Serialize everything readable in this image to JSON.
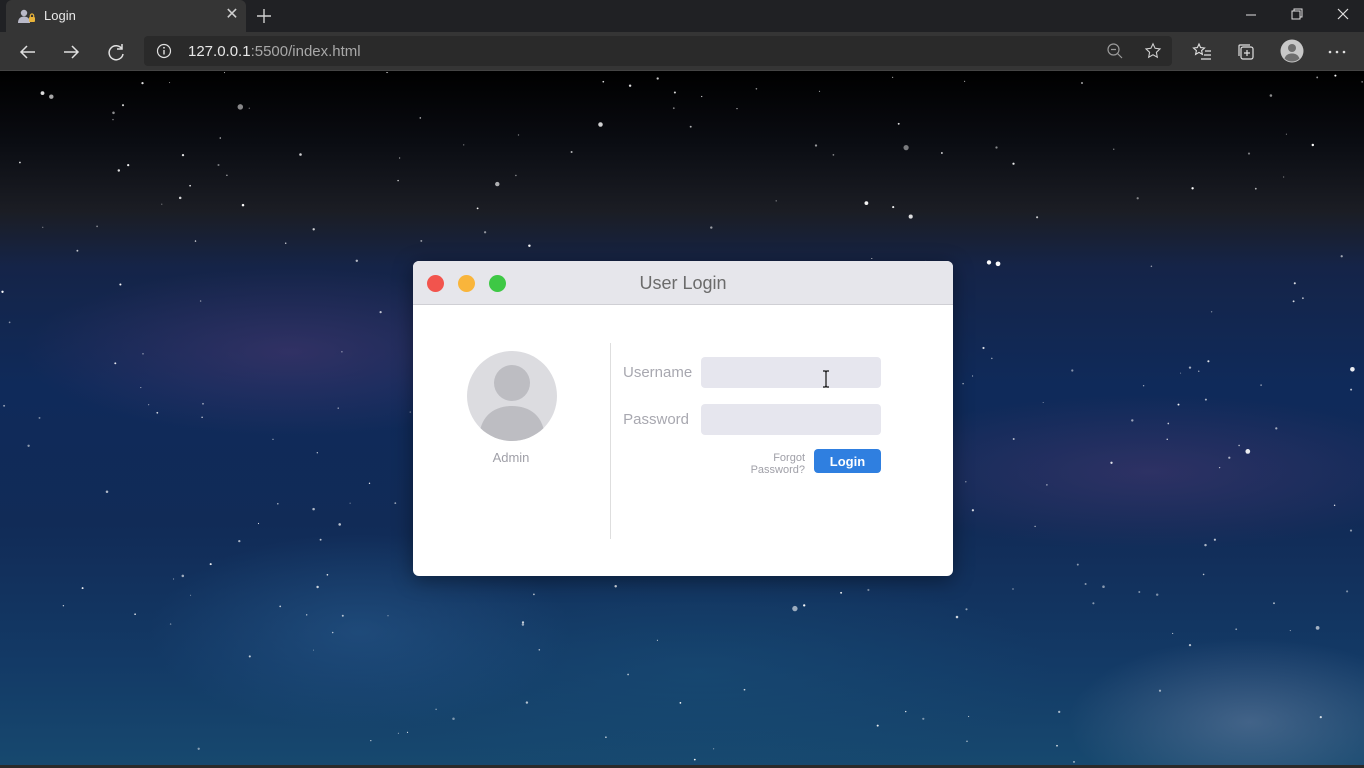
{
  "browser": {
    "tab": {
      "title": "Login"
    },
    "address_bar": {
      "url_host": "127.0.0.1",
      "url_rest": ":5500/index.html"
    }
  },
  "dialog": {
    "title": "User Login",
    "avatar": {
      "name": "Admin"
    },
    "username": {
      "label": "Username",
      "value": ""
    },
    "password": {
      "label": "Password",
      "value": ""
    },
    "forgot_label": "Forgot Password?",
    "login_label": "Login"
  },
  "colors": {
    "dot_close": "#f2544d",
    "dot_minimize": "#f9b53b",
    "dot_maximize": "#3ec845",
    "login_button": "#2f7fe0"
  },
  "icons": [
    "user-lock-icon",
    "close-icon",
    "plus-icon",
    "minimize-icon",
    "restore-icon",
    "back-icon",
    "forward-icon",
    "reload-icon",
    "info-icon",
    "zoom-out-icon",
    "star-icon",
    "favorites-icon",
    "collections-icon",
    "profile-icon",
    "more-icon",
    "user-silhouette-icon",
    "text-cursor-icon"
  ]
}
